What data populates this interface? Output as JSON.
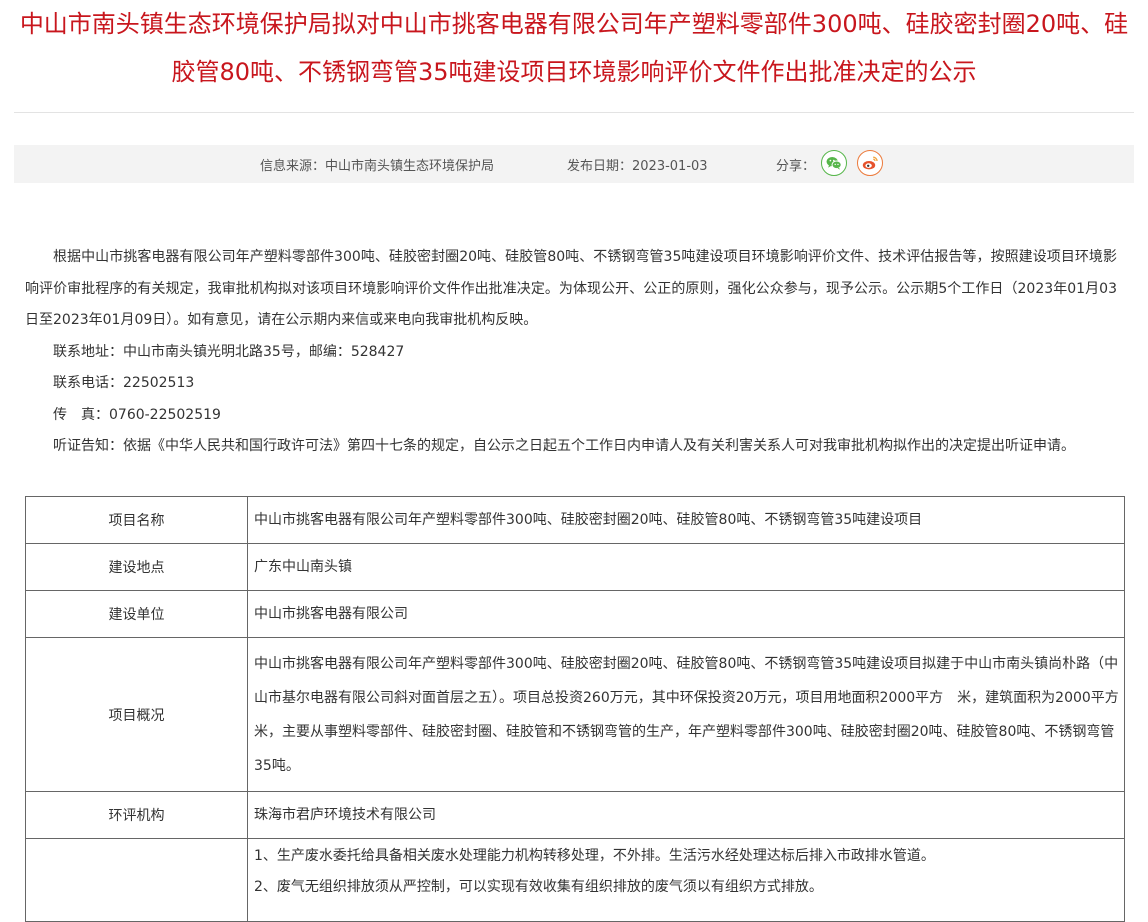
{
  "article": {
    "title": "中山市南头镇生态环境保护局拟对中山市挑客电器有限公司年产塑料零部件300吨、硅胶密封圈20吨、硅胶管80吨、不锈钢弯管35吨建设项目环境影响评价文件作出批准决定的公示"
  },
  "meta": {
    "source_label": "信息来源：",
    "source_value": "中山市南头镇生态环境保护局",
    "date_label": "发布日期：",
    "date_value": "2023-01-03",
    "share_label": "分享：",
    "share_icons": [
      "wechat-icon",
      "weibo-icon"
    ],
    "colors": {
      "title": "#c8161d",
      "wechat": "#56b64a",
      "weibo": "#ec7a3b"
    }
  },
  "body": {
    "intro": "根据中山市挑客电器有限公司年产塑料零部件300吨、硅胶密封圈20吨、硅胶管80吨、不锈钢弯管35吨建设项目环境影响评价文件、技术评估报告等，按照建设项目环境影响评价审批程序的有关规定，我审批机构拟对该项目环境影响评价文件作出批准决定。为体现公开、公正的原则，强化公众参与，现予公示。公示期5个工作日（2023年01月03日至2023年01月09日）。如有意见，请在公示期内来信或来电向我审批机构反映。",
    "address": "联系地址：中山市南头镇光明北路35号，邮编：528427",
    "phone": "联系电话：22502513",
    "fax": "传　真：0760-22502519",
    "hearing": "听证告知：依据《中华人民共和国行政许可法》第四十七条的规定，自公示之日起五个工作日内申请人及有关利害关系人可对我审批机构拟作出的决定提出听证申请。"
  },
  "table": {
    "rows": [
      {
        "label": "项目名称",
        "value": "中山市挑客电器有限公司年产塑料零部件300吨、硅胶密封圈20吨、硅胶管80吨、不锈钢弯管35吨建设项目"
      },
      {
        "label": "建设地点",
        "value": "广东中山南头镇"
      },
      {
        "label": "建设单位",
        "value": "中山市挑客电器有限公司"
      },
      {
        "label": "项目概况",
        "value": "中山市挑客电器有限公司年产塑料零部件300吨、硅胶密封圈20吨、硅胶管80吨、不锈钢弯管35吨建设项目拟建于中山市南头镇尚朴路（中山市基尔电器有限公司斜对面首层之五）。项目总投资260万元，其中环保投资20万元，项目用地面积2000平方　米，建筑面积为2000平方米，主要从事塑料零部件、硅胶密封圈、硅胶管和不锈钢弯管的生产，年产塑料零部件300吨、硅胶密封圈20吨、硅胶管80吨、不锈钢弯管35吨。"
      },
      {
        "label": "环评机构",
        "value": "珠海市君庐环境技术有限公司"
      }
    ],
    "measures": [
      "1、生产废水委托给具备相关废水处理能力机构转移处理，不外排。生活污水经处理达标后排入市政排水管道。",
      "2、废气无组织排放须从严控制，可以实现有效收集有组织排放的废气须以有组织方式排放。"
    ]
  }
}
